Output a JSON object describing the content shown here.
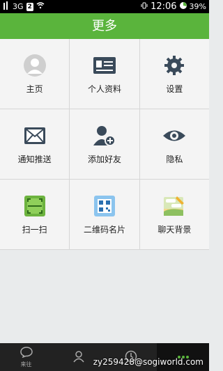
{
  "status_bar": {
    "network": "3G",
    "sim": "2",
    "time": "12:06",
    "battery": "39%"
  },
  "title": "更多",
  "grid": [
    {
      "label": "主页",
      "icon": "avatar-icon"
    },
    {
      "label": "个人资料",
      "icon": "id-card-icon"
    },
    {
      "label": "设置",
      "icon": "gear-icon"
    },
    {
      "label": "通知推送",
      "icon": "envelope-icon"
    },
    {
      "label": "添加好友",
      "icon": "add-user-icon"
    },
    {
      "label": "隐私",
      "icon": "eye-icon"
    },
    {
      "label": "扫一扫",
      "icon": "scan-icon"
    },
    {
      "label": "二维码名片",
      "icon": "qr-card-icon"
    },
    {
      "label": "聊天背景",
      "icon": "chat-background-icon"
    }
  ],
  "tabs": [
    {
      "label": "来往",
      "icon": "chat-bubble-icon"
    },
    {
      "label": "",
      "icon": "person-icon"
    },
    {
      "label": "",
      "icon": "clock-icon"
    },
    {
      "label": "",
      "icon": "more-dots-icon",
      "active": true
    }
  ],
  "watermark": "zy259428@sogiworld.com",
  "colors": {
    "accent": "#5ab43c",
    "title_text": "#ffffff",
    "status_bar": "#000000",
    "bottom_bar": "#222222"
  }
}
